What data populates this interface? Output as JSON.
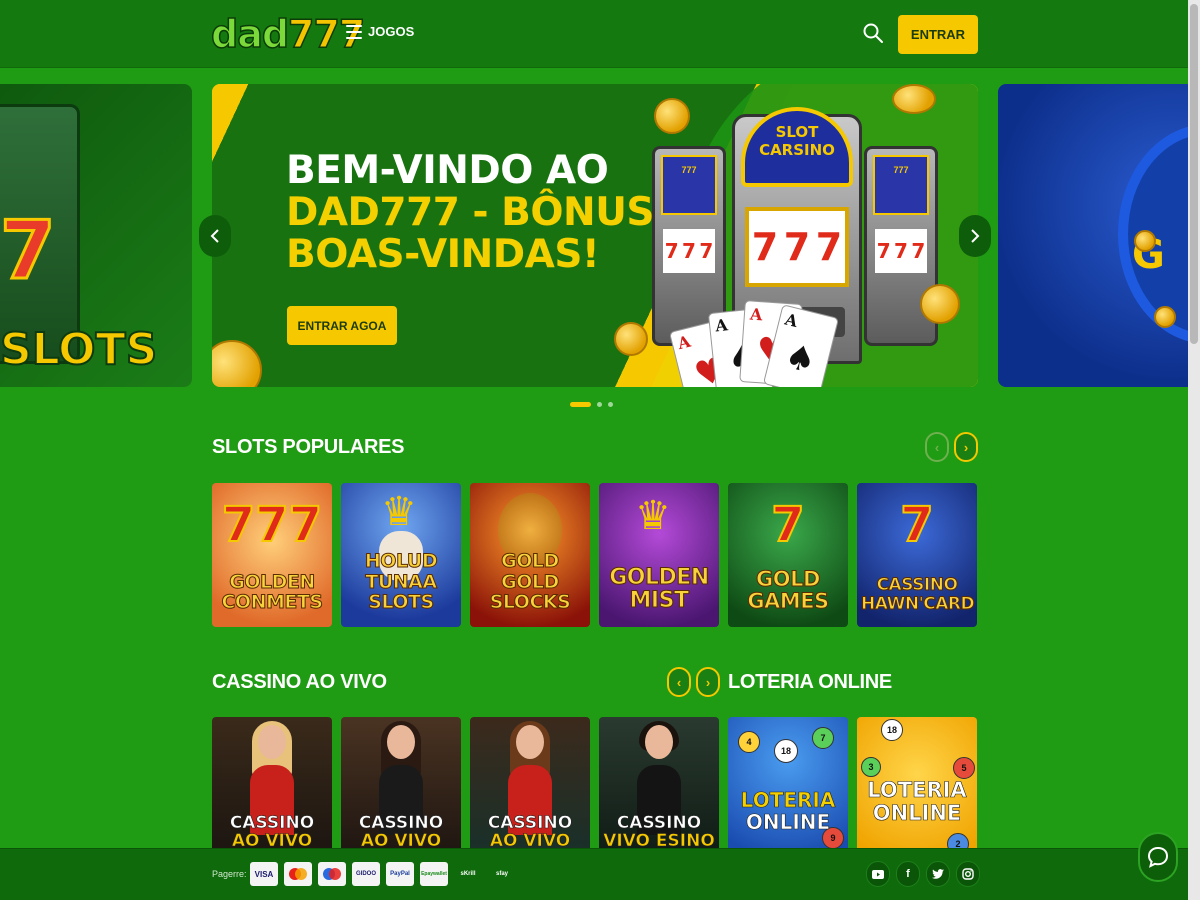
{
  "header": {
    "logo": {
      "part1": "dad",
      "part2": "777"
    },
    "menu_label": "JOGOS",
    "login_label": "ENTRAR"
  },
  "hero": {
    "title_line1": "BEM-VINDO AO",
    "title_line2": "DAD777 - BÔNUS DE",
    "title_line3": "BOAS-VINDAS!",
    "cta_label": "ENTRAR AGOA",
    "machine_title": "SLOT CARSINO",
    "side_left_label": "SLOTS",
    "side_right_label": "G",
    "slides_total": 3,
    "slide_active": 1
  },
  "slots": {
    "title": "SLOTS POPULARES",
    "items": [
      {
        "label": "GOLDEN CONMETS"
      },
      {
        "label": "HOLUD TUNAA SLOTS"
      },
      {
        "label": "GOLD GOLD SLOCKS"
      },
      {
        "label": "GOLDEN MIST"
      },
      {
        "label": "GOLD GAMES"
      },
      {
        "label": "CASSINO HAWN'CARD"
      }
    ]
  },
  "live": {
    "title": "CASSINO AO VIVO",
    "items": [
      {
        "line1": "CASSINO",
        "line2": "AO VIVO"
      },
      {
        "line1": "CASSINO",
        "line2": "AO VIVO"
      },
      {
        "line1": "CASSINO",
        "line2": "AO VIVO"
      },
      {
        "line1": "CASSINO",
        "line2": "VIVO ESINO"
      }
    ]
  },
  "lottery": {
    "title": "LOTERIA ONLINE",
    "items": [
      {
        "line1": "LOTERIA",
        "line2": "ONLINE"
      },
      {
        "line1": "LOTERIA",
        "line2": "ONLINE"
      }
    ]
  },
  "footer": {
    "payments_label": "Pagerre:",
    "payments": [
      "VISA",
      "MC",
      "MC",
      "GIDOO",
      "PayPal",
      "Epaywallet",
      "sKrill",
      "sfay"
    ],
    "social": [
      "youtube-icon",
      "facebook-icon",
      "twitter-icon",
      "instagram-icon"
    ]
  },
  "colors": {
    "page_bg": "#1f9b14",
    "header_bg": "#147a10",
    "accent_yellow": "#f5c800",
    "footer_bg": "#0f6a0c"
  }
}
